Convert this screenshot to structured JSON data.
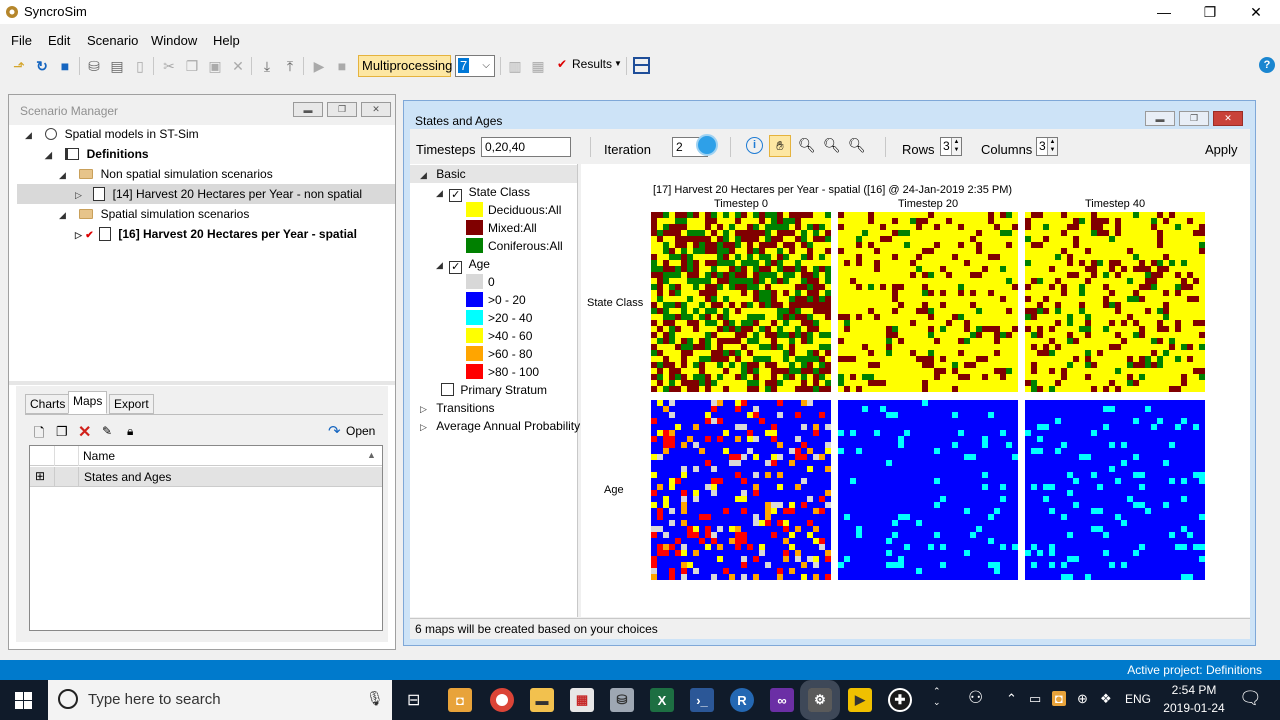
{
  "app": {
    "title": "SyncroSim",
    "window_controls": {
      "minimize": "—",
      "maximize": "❐",
      "close": "✕"
    }
  },
  "menu": [
    "File",
    "Edit",
    "Scenario",
    "Window",
    "Help"
  ],
  "toolbar": {
    "multiprocessing_label": "Multiprocessing",
    "threads_value": "7",
    "results_label": "Results"
  },
  "scenario_manager": {
    "title": "Scenario Manager",
    "tree": {
      "library": "Spatial models in ST-Sim",
      "definitions": "Definitions",
      "folder_non_spatial": "Non spatial simulation scenarios",
      "scenario_14": "[14] Harvest 20 Hectares per Year - non spatial",
      "folder_spatial": "Spatial simulation scenarios",
      "scenario_16": "[16] Harvest 20 Hectares per Year - spatial"
    },
    "tabs": [
      "Charts",
      "Maps",
      "Export"
    ],
    "active_tab": "Maps",
    "open_label": "Open",
    "list_header": "Name",
    "list_items": [
      "States and Ages"
    ]
  },
  "states_ages": {
    "title": "States and Ages",
    "timesteps_label": "Timesteps",
    "timesteps_value": "0,20,40",
    "iteration_label": "Iteration",
    "iteration_value": "2",
    "rows_label": "Rows",
    "rows_value": "3",
    "columns_label": "Columns",
    "columns_value": "3",
    "apply_label": "Apply",
    "layers": {
      "basic": "Basic",
      "state_class": "State Class",
      "state_class_items": [
        {
          "label": "Deciduous:All",
          "color": "#ffff00"
        },
        {
          "label": "Mixed:All",
          "color": "#800000"
        },
        {
          "label": "Coniferous:All",
          "color": "#008000"
        }
      ],
      "age": "Age",
      "age_items": [
        {
          "label": "0",
          "color": "#d8d8d8"
        },
        {
          "label": ">0 - 20",
          "color": "#0000ff"
        },
        {
          "label": ">20 - 40",
          "color": "#00ffff"
        },
        {
          "label": ">40 - 60",
          "color": "#ffff00"
        },
        {
          "label": ">60 - 80",
          "color": "#ffa500"
        },
        {
          "label": ">80 - 100",
          "color": "#ff0000"
        }
      ],
      "primary_stratum": "Primary Stratum",
      "transitions": "Transitions",
      "avg_annual_prob": "Average Annual Probability"
    },
    "map_title": "[17] Harvest 20 Hectares per Year - spatial ([16] @ 24-Jan-2019 2:35 PM)",
    "timestep_headers": [
      "Timestep 0",
      "Timestep 20",
      "Timestep 40"
    ],
    "row_labels": [
      "State Class",
      "Age"
    ],
    "status": "6 maps will be created based on your choices"
  },
  "statusbar": {
    "text": "Active project: Definitions"
  },
  "taskbar": {
    "search_placeholder": "Type here to search",
    "language": "ENG",
    "time": "2:54 PM",
    "date": "2019-01-24"
  }
}
